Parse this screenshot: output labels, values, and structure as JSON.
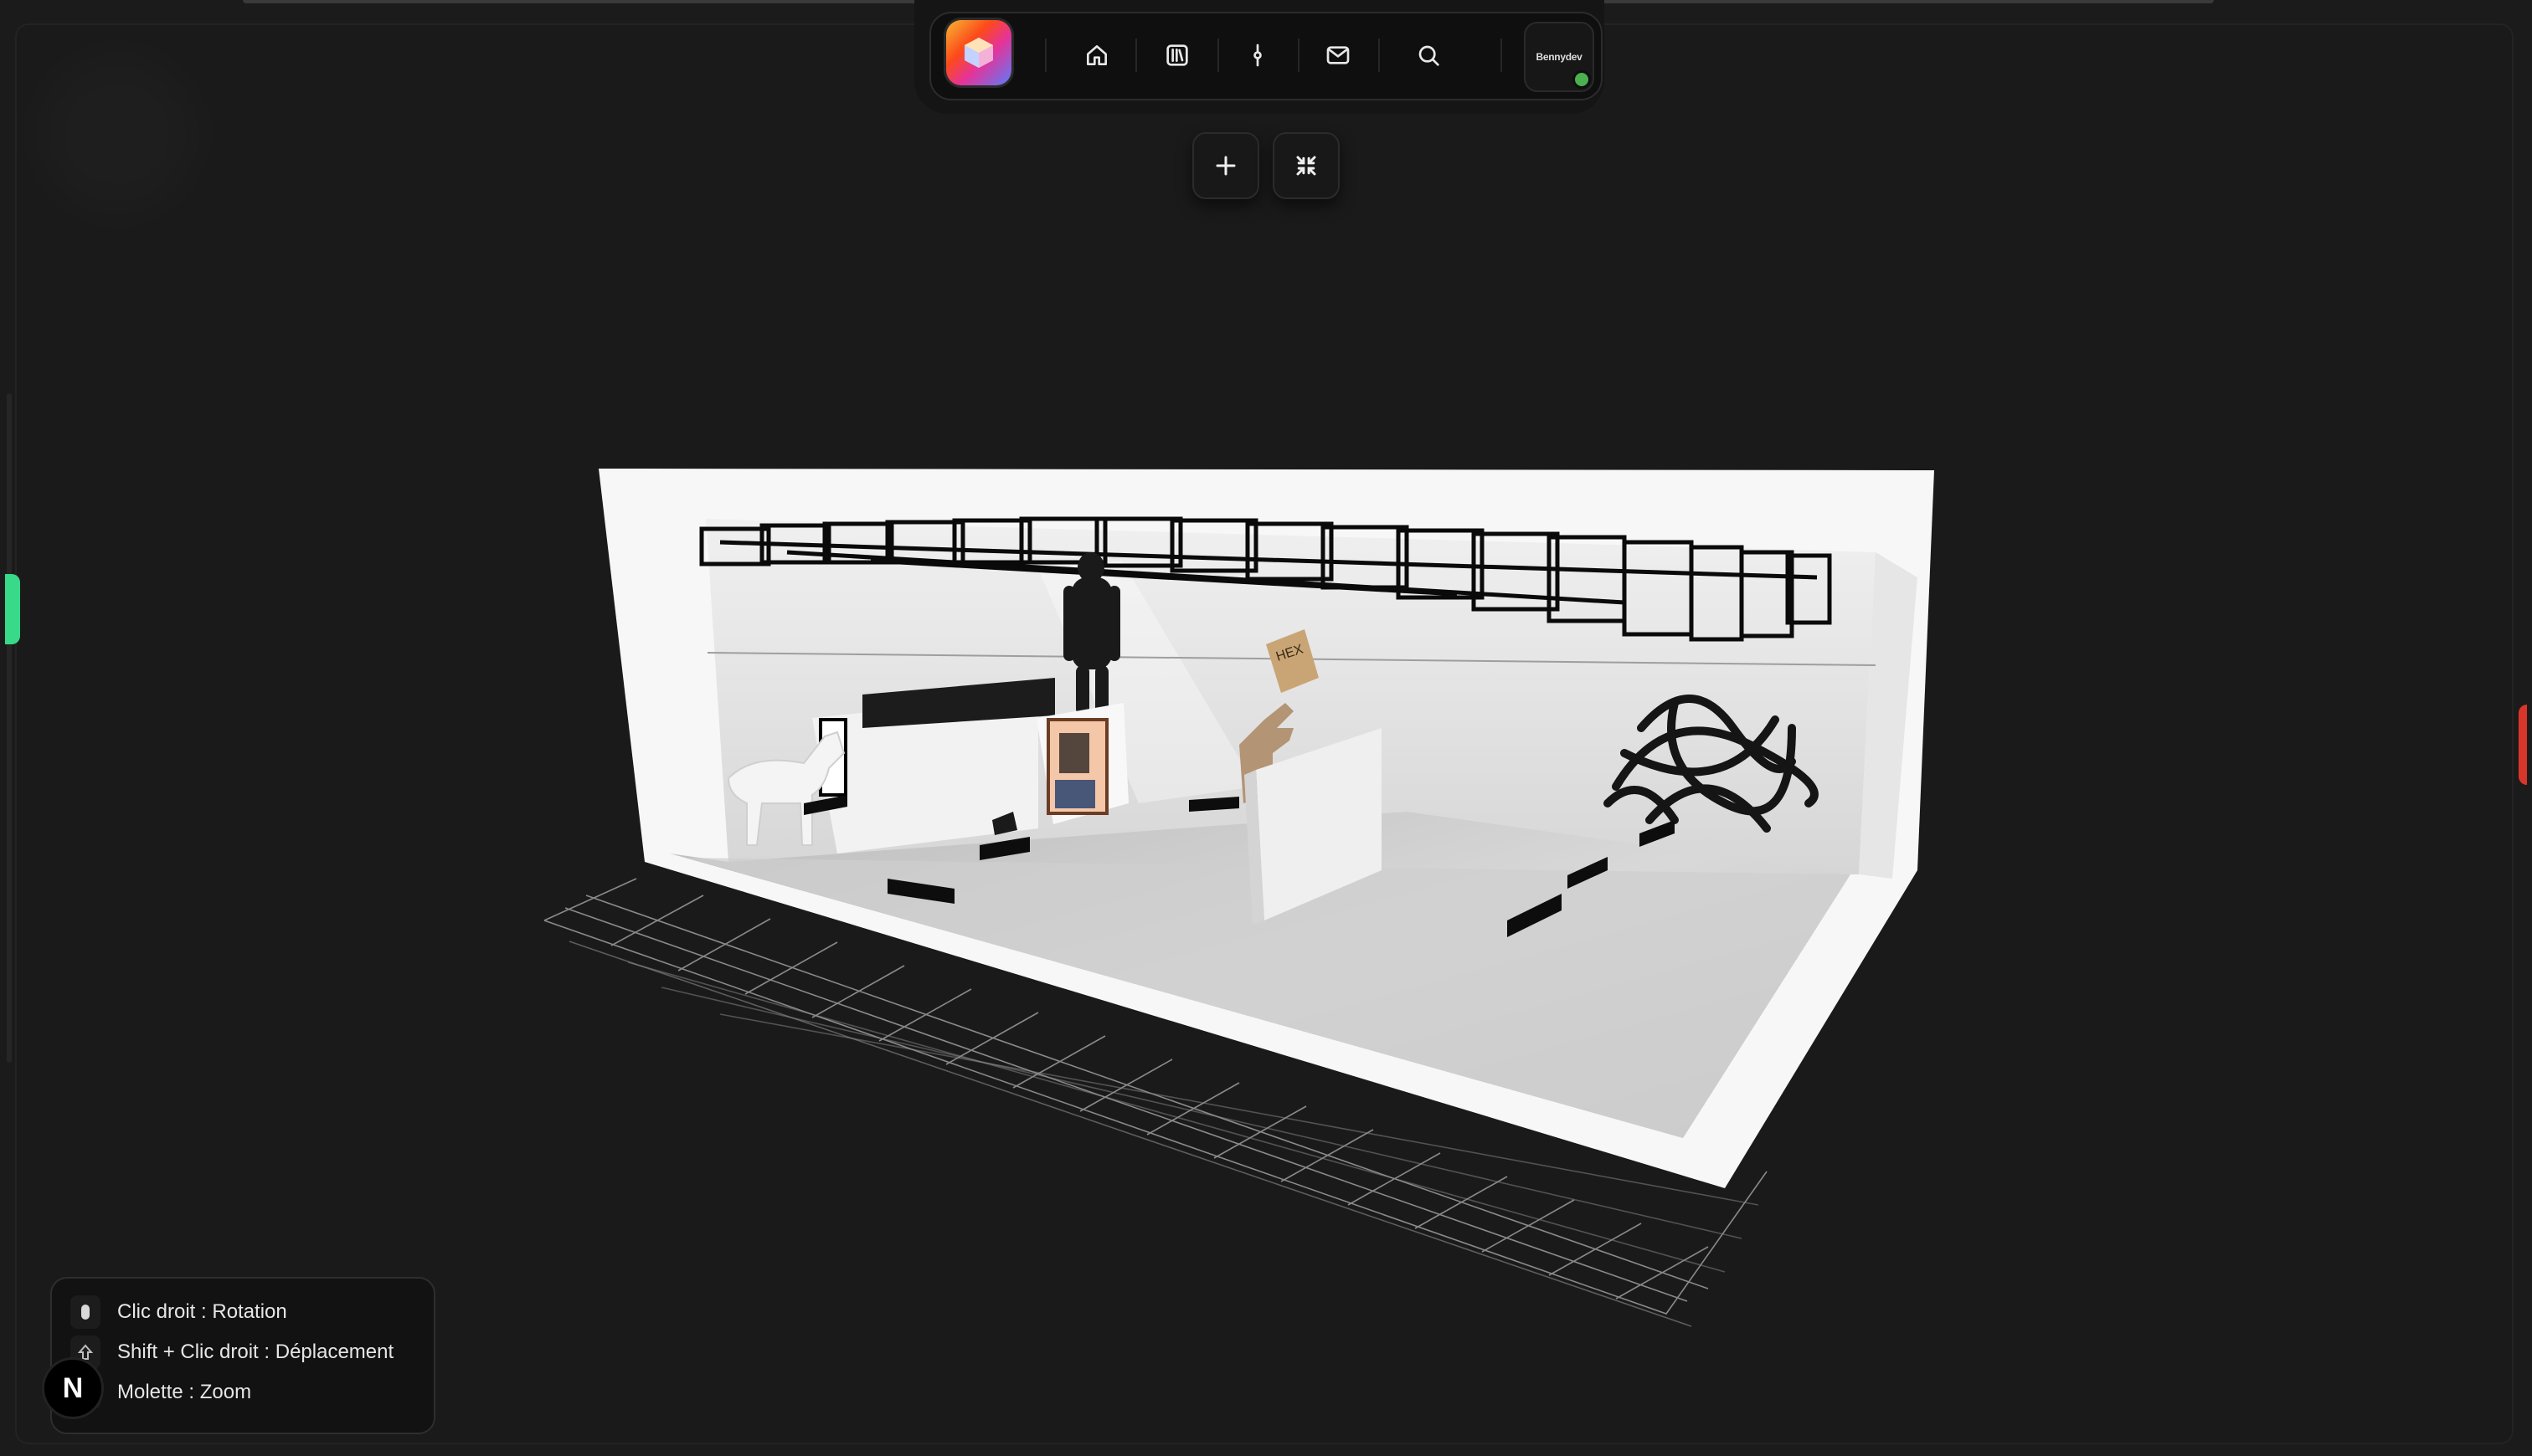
{
  "nav": {
    "logo_icon": "app-cube-logo",
    "items": [
      {
        "name": "home",
        "icon": "home-icon"
      },
      {
        "name": "library",
        "icon": "library-icon"
      },
      {
        "name": "commits",
        "icon": "git-commit-icon"
      },
      {
        "name": "mail",
        "icon": "mail-icon"
      },
      {
        "name": "search",
        "icon": "search-icon"
      }
    ],
    "user_label": "Bennydev",
    "status_color": "#4caf50"
  },
  "toolbar": {
    "add_icon": "plus-icon",
    "collapse_icon": "shrink-arrows-icon"
  },
  "controls_help": {
    "items": [
      {
        "icon": "mouse-icon",
        "text": "Clic droit : Rotation"
      },
      {
        "icon": "shift-arrow-icon",
        "text": "Shift + Clic droit : Déplacement"
      },
      {
        "icon": "scroll-wheel-icon",
        "text": "Molette : Zoom"
      }
    ]
  },
  "dev_badge": {
    "label": "N"
  },
  "colors": {
    "accent_left": "#39d98a",
    "accent_right": "#d9362b",
    "background": "#1b1b1b"
  }
}
